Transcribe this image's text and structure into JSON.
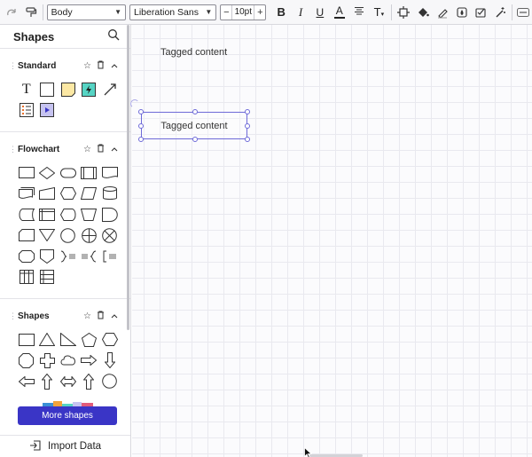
{
  "toolbar": {
    "style_value": "Body",
    "font_value": "Liberation Sans",
    "font_size": "10pt",
    "minus": "−",
    "plus": "+",
    "bold": "B",
    "italic": "I",
    "underline": "U",
    "text_color": "A",
    "text_size": "T"
  },
  "sidebar": {
    "title": "Shapes",
    "sections": {
      "standard": "Standard",
      "flowchart": "Flowchart",
      "shapes": "Shapes"
    },
    "standard_text_glyph": "T",
    "more_shapes": "More shapes",
    "import_data": "Import Data"
  },
  "canvas": {
    "free_text": "Tagged content",
    "selected_shape_text": "Tagged content"
  },
  "colors": {
    "accent": "#3a35c6",
    "selection": "#6e6ad8",
    "note_yellow": "#fce8a4",
    "teal": "#56d4c4",
    "purple_box": "#c6c3f0"
  }
}
